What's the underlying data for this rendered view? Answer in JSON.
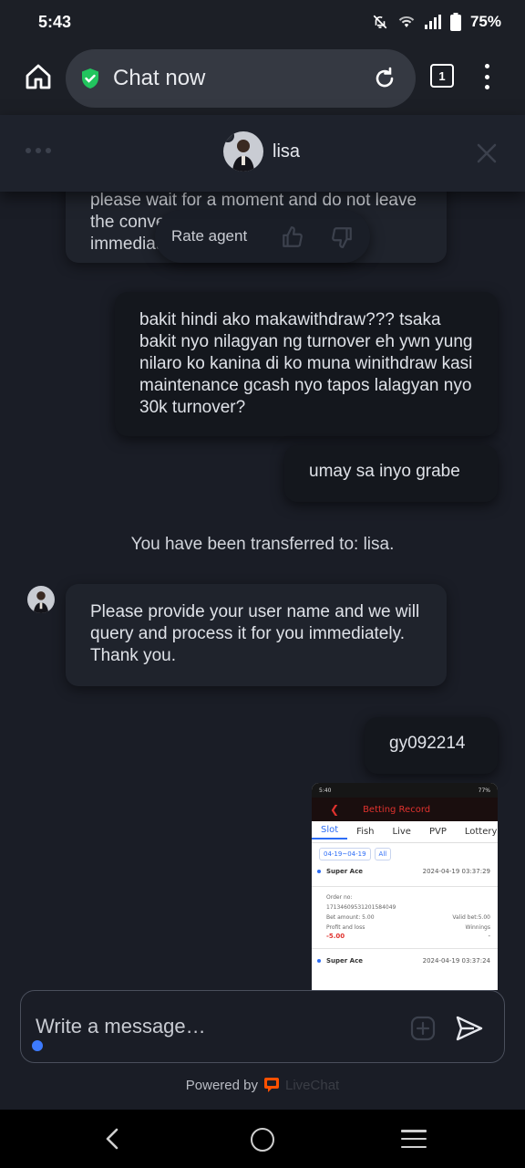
{
  "status_bar": {
    "time": "5:43",
    "battery": "75%"
  },
  "browser": {
    "url_title": "Chat now",
    "tab_count": "1"
  },
  "chat_header": {
    "agent_name": "lisa"
  },
  "messages": {
    "agent_prev": "please wait for a moment and do not leave the conversation. We will check immediately",
    "rate_label": "Rate agent",
    "user_1": "bakit hindi ako makawithdraw??? tsaka bakit nyo nilagyan ng turnover eh ywn yung nilaro ko kanina di ko muna winithdraw kasi maintenance gcash nyo tapos lalagyan nyo 30k turnover?",
    "user_2": "umay sa inyo grabe",
    "system": "You have been transferred to: lisa.",
    "agent_2": "Please provide your user name and we will query and process it for you immediately. Thank you.",
    "user_3": "gy092214"
  },
  "screenshot": {
    "time": "5:40",
    "battery": "77%",
    "title": "Betting Record",
    "tabs": [
      "Slot",
      "Fish",
      "Live",
      "PVP",
      "Lottery"
    ],
    "date_filter": "04-19~04-19",
    "all_filter": "All",
    "record_name": "Super Ace",
    "record_time": "2024-04-19 03:37:29",
    "order_label": "Order no:",
    "order_no": "17134609531201584049",
    "bet_amount": "Bet amount: 5.00",
    "valid_bet": "Valid bet:5.00",
    "profit_label": "Profit and loss",
    "winnings_label": "Winnings",
    "profit_value": "-5.00",
    "winnings_value": "-",
    "record2_name": "Super Ace",
    "record2_time": "2024-04-19 03:37:24"
  },
  "composer": {
    "placeholder": "Write a message…"
  },
  "footer": {
    "powered_by": "Powered by",
    "brand": "LiveChat"
  },
  "colors": {
    "accent": "#3d7bff",
    "shield": "#22c55e",
    "livechat": "#ff5100",
    "loss": "#e0322e"
  }
}
